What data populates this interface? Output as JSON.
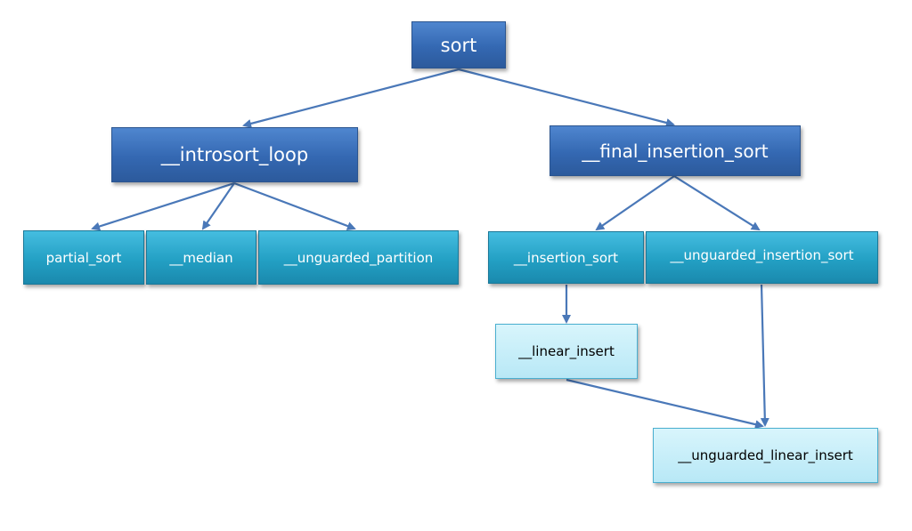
{
  "nodes": {
    "sort": "sort",
    "introsort_loop": "__introsort_loop",
    "final_insertion_sort": "__final_insertion_sort",
    "partial_sort": "partial_sort",
    "median": "__median",
    "unguarded_partition": "__unguarded_partition",
    "insertion_sort": "__insertion_sort",
    "unguarded_insertion_sort": "__unguarded_insertion_sort",
    "linear_insert": "__linear_insert",
    "unguarded_linear_insert": "__unguarded_linear_insert"
  },
  "edges": [
    [
      "sort",
      "introsort_loop"
    ],
    [
      "sort",
      "final_insertion_sort"
    ],
    [
      "introsort_loop",
      "partial_sort"
    ],
    [
      "introsort_loop",
      "median"
    ],
    [
      "introsort_loop",
      "unguarded_partition"
    ],
    [
      "final_insertion_sort",
      "insertion_sort"
    ],
    [
      "final_insertion_sort",
      "unguarded_insertion_sort"
    ],
    [
      "insertion_sort",
      "linear_insert"
    ],
    [
      "unguarded_insertion_sort",
      "unguarded_linear_insert"
    ],
    [
      "linear_insert",
      "unguarded_linear_insert"
    ]
  ],
  "colors": {
    "level1": "#3468b2",
    "level2": "#23a0c4",
    "level3": "#c8eef8",
    "edge": "#4a78b8"
  }
}
